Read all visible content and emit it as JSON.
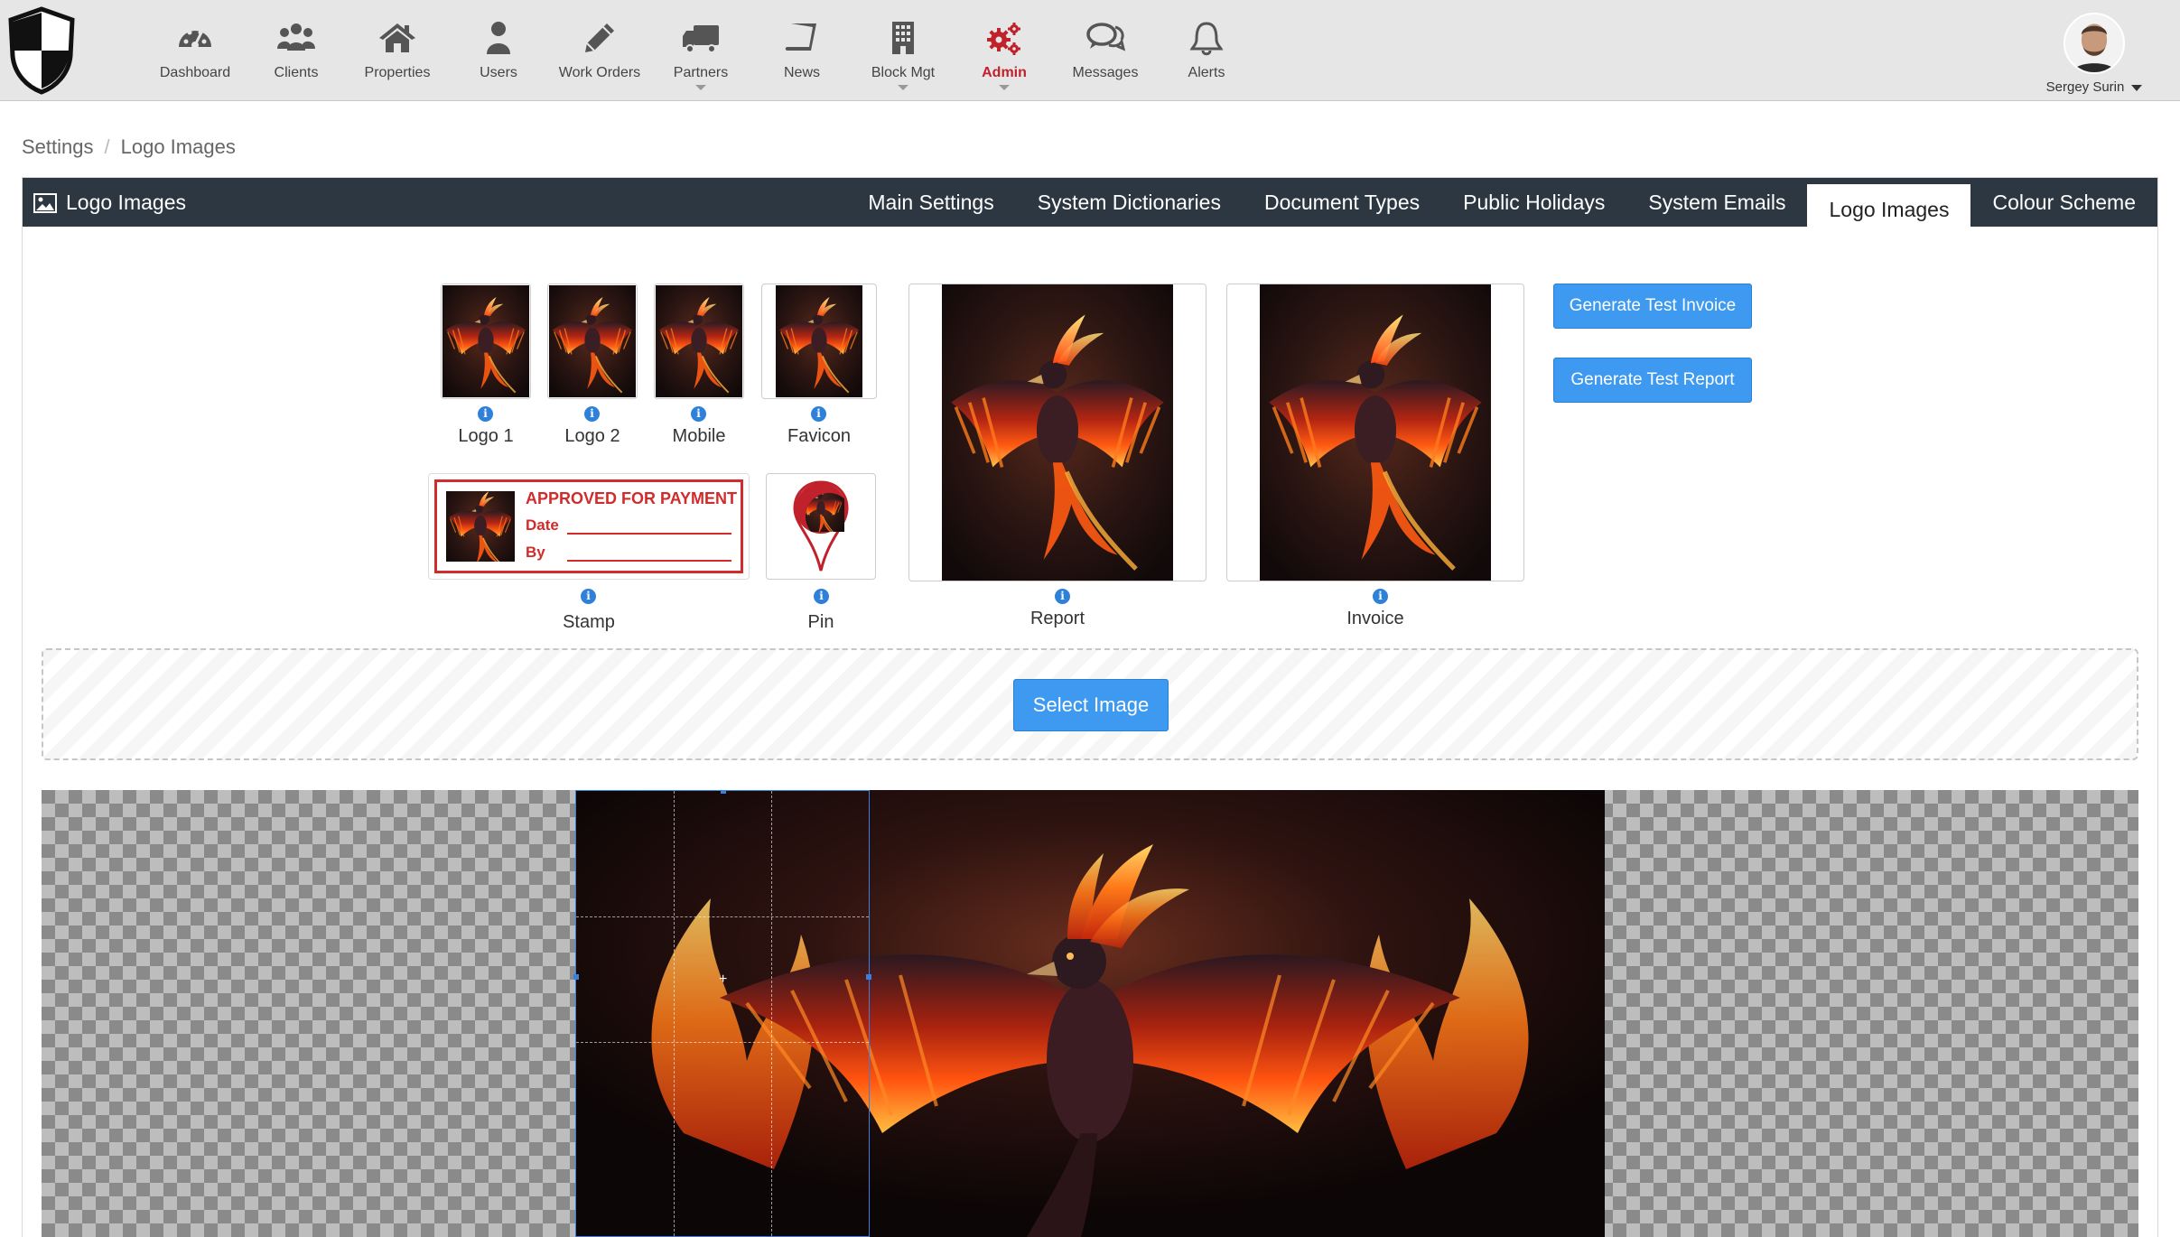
{
  "nav": {
    "items": [
      {
        "label": "Dashboard",
        "icon": "dashboard-gauge-icon"
      },
      {
        "label": "Clients",
        "icon": "clients-group-icon"
      },
      {
        "label": "Properties",
        "icon": "home-icon"
      },
      {
        "label": "Users",
        "icon": "user-icon"
      },
      {
        "label": "Work Orders",
        "icon": "pencil-icon"
      },
      {
        "label": "Partners",
        "icon": "truck-icon"
      },
      {
        "label": "News",
        "icon": "book-icon"
      },
      {
        "label": "Block Mgt",
        "icon": "building-icon"
      },
      {
        "label": "Admin",
        "icon": "cogs-icon"
      },
      {
        "label": "Messages",
        "icon": "chat-bubbles-icon"
      },
      {
        "label": "Alerts",
        "icon": "bell-icon"
      }
    ],
    "active": "Admin"
  },
  "user": {
    "name": "Sergey Surin"
  },
  "breadcrumb": {
    "root": "Settings",
    "current": "Logo Images"
  },
  "panel": {
    "title": "Logo Images",
    "tabs": [
      "Main Settings",
      "System Dictionaries",
      "Document Types",
      "Public Holidays",
      "System Emails",
      "Logo Images",
      "Colour Scheme"
    ],
    "active_tab": "Logo Images"
  },
  "images": {
    "logo1": "Logo 1",
    "logo2": "Logo 2",
    "mobile": "Mobile",
    "favicon": "Favicon",
    "stamp": "Stamp",
    "pin": "Pin",
    "report": "Report",
    "invoice": "Invoice"
  },
  "stamp": {
    "title": "APPROVED FOR PAYMENT",
    "date_label": "Date",
    "by_label": "By"
  },
  "buttons": {
    "test_invoice": "Generate Test Invoice",
    "test_report": "Generate Test Report",
    "select_image": "Select Image"
  },
  "colors": {
    "navbar_bg": "#e6e6e6",
    "active_nav": "#c0212b",
    "panel_header": "#2d3741",
    "button_blue": "#3d9af0",
    "stamp_red": "#d12b2b"
  }
}
